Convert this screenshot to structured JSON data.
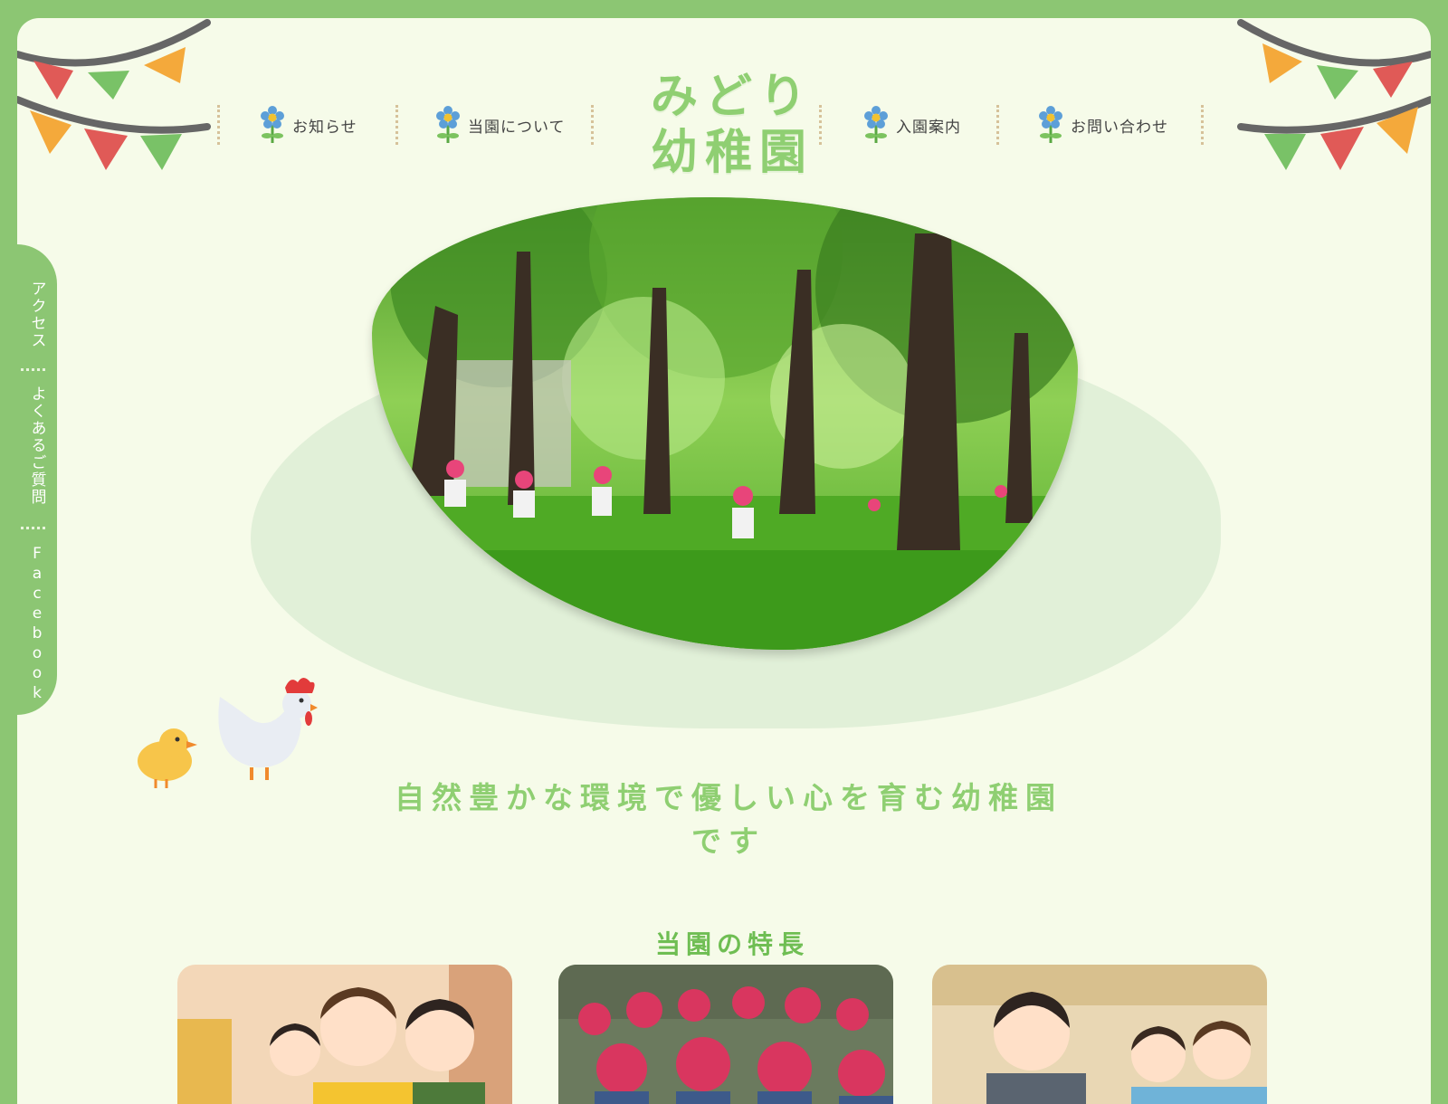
{
  "site": {
    "logo_line1": "みどり",
    "logo_line2": "幼稚園"
  },
  "nav": {
    "items": [
      {
        "label": "お知らせ",
        "icon": "flower-icon"
      },
      {
        "label": "当園について",
        "icon": "flower-icon"
      },
      {
        "label": "入園案内",
        "icon": "flower-icon"
      },
      {
        "label": "お問い合わせ",
        "icon": "flower-icon"
      }
    ]
  },
  "side_tab": {
    "items": [
      {
        "label": "アクセス"
      },
      {
        "label": "よくあるご質問"
      },
      {
        "label": "Facebook"
      }
    ]
  },
  "hero": {
    "tagline": "自然豊かな環境で優しい心を育む幼稚園です"
  },
  "features": {
    "title": "当園の特長"
  },
  "colors": {
    "frame": "#8cc673",
    "background": "#f6fbe9",
    "accent": "#8fcf72",
    "hero_blob": "#e1f0d8",
    "flag_red": "#e05a57",
    "flag_green": "#79c267",
    "flag_orange": "#f4a93b"
  }
}
